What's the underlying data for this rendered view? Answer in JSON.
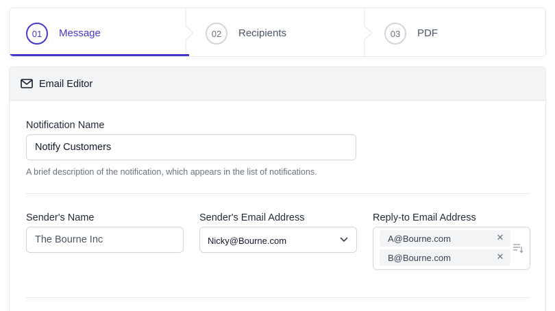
{
  "stepper": {
    "steps": [
      {
        "number": "01",
        "label": "Message"
      },
      {
        "number": "02",
        "label": "Recipients"
      },
      {
        "number": "03",
        "label": "PDF"
      }
    ]
  },
  "editor": {
    "title": "Email Editor",
    "icon": "mail-icon",
    "notification_name": {
      "label": "Notification Name",
      "value": "Notify Customers",
      "help": "A brief description of the notification, which appears in the list of notifications."
    },
    "sender_name": {
      "label": "Sender's Name",
      "value": "The Bourne Inc"
    },
    "sender_email": {
      "label": "Sender's Email Address",
      "value": "Nicky@Bourne.com"
    },
    "reply_to": {
      "label": "Reply-to Email Address",
      "chips": [
        "A@Bourne.com",
        "B@Bourne.com"
      ]
    }
  },
  "colors": {
    "accent": "#4338ca",
    "border": "#d1d5db",
    "header_bg": "#f3f4f6"
  }
}
